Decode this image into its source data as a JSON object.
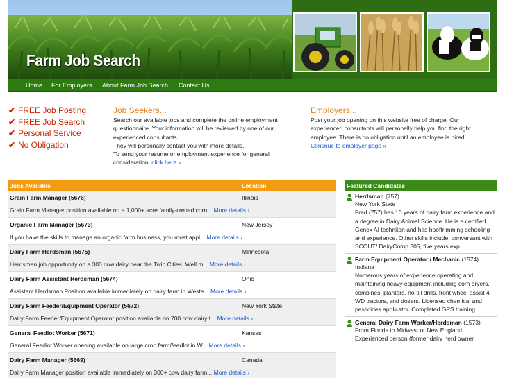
{
  "site": {
    "brand": "Farm Job Search"
  },
  "nav": {
    "items": [
      {
        "label": "Home"
      },
      {
        "label": "For Employers"
      },
      {
        "label": "About Farm Job Search"
      },
      {
        "label": "Contact Us"
      }
    ]
  },
  "features": [
    {
      "label": "FREE Job Posting"
    },
    {
      "label": "FREE Job Search"
    },
    {
      "label": "Personal Service"
    },
    {
      "label": "No Obligation"
    }
  ],
  "seekers": {
    "heading": "Job Seekers...",
    "para1": "Search our available jobs and complete the online employment questionnaire. Your information will be reviewed by one of our experienced consultants.",
    "para2": "They will personally contact you with more details.",
    "para3": "To send your resume or employment experience for general consideration,",
    "link": "click here »"
  },
  "employers": {
    "heading": "Employers...",
    "para": "Post your job opening on this website free of charge. Our experienced consultants will personally help you find the right employee. There is no obligation until an employee is hired.",
    "link": "Continue to employer page »"
  },
  "jobs": {
    "col_jobs": "Jobs Available",
    "col_location": "Location",
    "more_label": "More details ›",
    "rows": [
      {
        "title": "Grain Farm Manager (5676)",
        "location": "Illinois",
        "desc": "Grain Farm Manager position available on a 1,000+ acre family-owned corn..."
      },
      {
        "title": "Organic Farm Manager (5673)",
        "location": "New Jersey",
        "desc": "If you have the skills to manage an organic farm business, you must appl..."
      },
      {
        "title": "Dairy Farm Herdsman (5675)",
        "location": "Minnesota",
        "desc": "Herdsman job opportunity on a 300 cow dairy near the Twin Cities. Well m..."
      },
      {
        "title": "Dairy Farm Assistant Herdsman (5674)",
        "location": "Ohio",
        "desc": "Assistant Herdsman Position available immediately on dairy farm in Weste..."
      },
      {
        "title": "Dairy Farm Feeder/Equipment Operator (5672)",
        "location": "New York State",
        "desc": "Dairy Farm Feeder/Equipment Operator position available on 700 cow dairy f..."
      },
      {
        "title": "General Feedlot Worker (5671)",
        "location": "Kansas",
        "desc": "General Feedlot Worker opening available on large crop farm/feedlot in W..."
      },
      {
        "title": "Dairy Farm Manager (5669)",
        "location": "Canada",
        "desc": "Dairy Farm Manager position available immediately on 300+ cow dairy farm..."
      }
    ]
  },
  "featured": {
    "heading": "Featured Candidates",
    "candidates": [
      {
        "role": "Herdsman",
        "num": " (757)",
        "body": "New York State\nFred (757) has 10 years of dairy farm experience and a degree in Dairy Animal Science. He is a certified Genex AI techniton and has hooftrimming schooling and experience. Other skills include: conversant with SCOUT/ DairyComp 305, five years exp"
      },
      {
        "role": "Farm Equipment Operator / Mechanic",
        "num": " (1574)",
        "body": "Indiana\nNumerous years of experience operating and maintaining heavy equipment including corn dryers, combines, planters, no-till drills, front wheel assist 4 WD tractors, and dozers. Licensed chemical and pesticides applicator. Completed GPS training."
      },
      {
        "role": "General Dairy Farm Worker/Herdsman",
        "num": " (1573)",
        "body": "From Florida to Midwest or New England\nExperienced person (former dairy herd owner"
      }
    ]
  },
  "colors": {
    "nav_green": "#2d7a10",
    "orange": "#f39c12",
    "feature_red": "#cc2200",
    "featured_green": "#3a8a17",
    "link_blue": "#1a55c8"
  }
}
